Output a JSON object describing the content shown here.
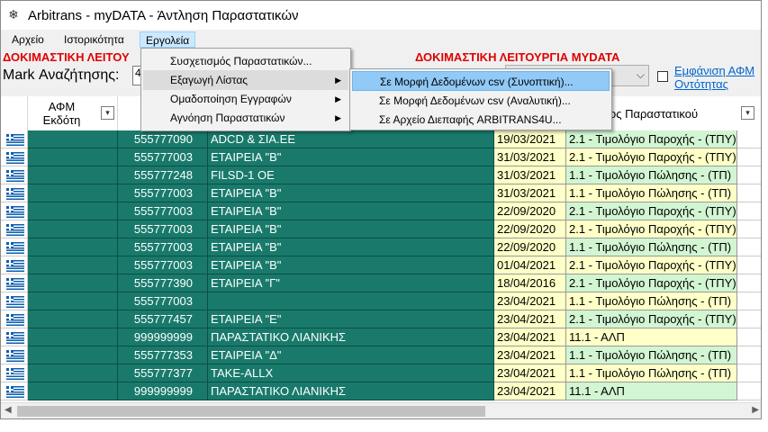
{
  "window": {
    "title": "Arbitrans - myDATA - Άντληση Παραστατικών"
  },
  "menubar": {
    "items": [
      "Αρχείο",
      "Ιστορικότητα",
      "Εργολεία"
    ]
  },
  "toolbar": {
    "test_mode_left": "ΔΟΚΙΜΑΣΤΙΚΗ ΛΕΙΤΟΥ",
    "test_mode_right": "ΔΟΚΙΜΑΣΤΙΚΗ ΛΕΙΤΟΥΡΓΙΑ MYDATA",
    "mark_label": "Mark Αναζήτησης:",
    "mark_value": "4",
    "show_link": "Εμφάνιση ΑΦΜ Οντότητας"
  },
  "grid": {
    "headers": {
      "afm_issuer": "ΑΦΜ Εκδότη",
      "doc_type": "ος Παραστατικού"
    },
    "rows": [
      {
        "vat": "555777090",
        "name": "ADCD & ΣΙΑ.ΕΕ",
        "date": "19/03/2021",
        "type": "2.1 - Τιμολόγιο Παροχής - (ΤΠΥ)",
        "color": "green"
      },
      {
        "vat": "555777003",
        "name": "ΕΤΑΙΡΕΙΑ \"Β\"",
        "date": "31/03/2021",
        "type": "2.1 - Τιμολόγιο Παροχής - (ΤΠΥ)",
        "color": "yellow"
      },
      {
        "vat": "555777248",
        "name": "FILSD-1 OE",
        "date": "31/03/2021",
        "type": "1.1 - Τιμολόγιο Πώλησης - (ΤΠ)",
        "color": "green"
      },
      {
        "vat": "555777003",
        "name": "ΕΤΑΙΡΕΙΑ \"Β\"",
        "date": "31/03/2021",
        "type": "1.1 - Τιμολόγιο Πώλησης - (ΤΠ)",
        "color": "yellow"
      },
      {
        "vat": "555777003",
        "name": "ΕΤΑΙΡΕΙΑ \"Β\"",
        "date": "22/09/2020",
        "type": "2.1 - Τιμολόγιο Παροχής - (ΤΠΥ)",
        "color": "green"
      },
      {
        "vat": "555777003",
        "name": "ΕΤΑΙΡΕΙΑ \"Β\"",
        "date": "22/09/2020",
        "type": "2.1 - Τιμολόγιο Παροχής - (ΤΠΥ)",
        "color": "yellow"
      },
      {
        "vat": "555777003",
        "name": "ΕΤΑΙΡΕΙΑ \"Β\"",
        "date": "22/09/2020",
        "type": "1.1 - Τιμολόγιο Πώλησης - (ΤΠ)",
        "color": "green"
      },
      {
        "vat": "555777003",
        "name": "ΕΤΑΙΡΕΙΑ \"Β\"",
        "date": "01/04/2021",
        "type": "2.1 - Τιμολόγιο Παροχής - (ΤΠΥ)",
        "color": "yellow"
      },
      {
        "vat": "555777390",
        "name": "ΕΤΑΙΡΕΙΑ \"Γ\"",
        "date": "18/04/2016",
        "type": "2.1 - Τιμολόγιο Παροχής - (ΤΠΥ)",
        "color": "green"
      },
      {
        "vat": "555777003",
        "name": "",
        "date": "23/04/2021",
        "type": "1.1 - Τιμολόγιο Πώλησης - (ΤΠ)",
        "color": "yellow"
      },
      {
        "vat": "555777457",
        "name": "ΕΤΑΙΡΕΙΑ \"Ε\"",
        "date": "23/04/2021",
        "type": "2.1 - Τιμολόγιο Παροχής - (ΤΠΥ)",
        "color": "green"
      },
      {
        "vat": "999999999",
        "name": "ΠΑΡΑΣΤΑΤΙΚΟ ΛΙΑΝΙΚΗΣ",
        "date": "23/04/2021",
        "type": "11.1 - ΑΛΠ",
        "color": "yellow"
      },
      {
        "vat": "555777353",
        "name": "ΕΤΑΙΡΕΙΑ \"Δ\"",
        "date": "23/04/2021",
        "type": "1.1 - Τιμολόγιο Πώλησης - (ΤΠ)",
        "color": "green"
      },
      {
        "vat": "555777377",
        "name": "TAKE-ALLX",
        "date": "23/04/2021",
        "type": "1.1 - Τιμολόγιο Πώλησης - (ΤΠ)",
        "color": "yellow"
      },
      {
        "vat": "999999999",
        "name": "ΠΑΡΑΣΤΑΤΙΚΟ ΛΙΑΝΙΚΗΣ",
        "date": "23/04/2021",
        "type": "11.1 - ΑΛΠ",
        "color": "green"
      }
    ]
  },
  "tools_menu": {
    "items": [
      "Συσχετισμός Παραστατικών...",
      "Εξαγωγή Λίστας",
      "Ομαδοποίηση Εγγραφών",
      "Αγνόηση Παραστατικών"
    ]
  },
  "export_submenu": {
    "items": [
      "Σε Μορφή Δεδομένων csv (Συνοπτική)...",
      "Σε Μορφή Δεδομένων csv (Αναλυτική)...",
      "Σε Αρχείο Διεπαφής ARBITRANS4U..."
    ]
  },
  "colors": {
    "row_fill": "#197a6b",
    "date_fill": "#ffffc8",
    "green_fill": "#d2f5d2",
    "test_mode": "#e00000",
    "highlight": "#91c9f7"
  }
}
